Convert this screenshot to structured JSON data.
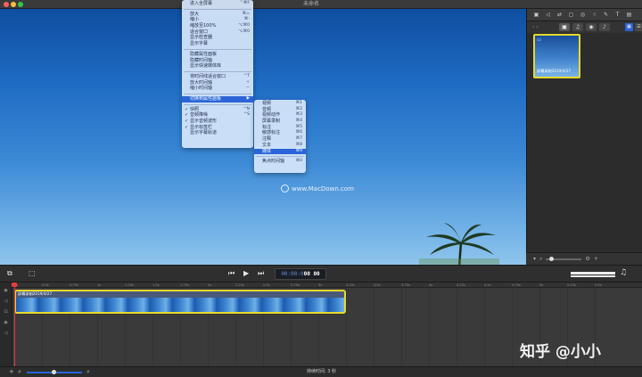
{
  "window": {
    "title": "未命名"
  },
  "menu_view": {
    "items": [
      {
        "label": "进入全屏幕",
        "shortcut": "⌃⌘F"
      },
      {
        "sep": true
      },
      {
        "label": "放大",
        "shortcut": "⌘="
      },
      {
        "label": "缩小",
        "shortcut": "⌘-"
      },
      {
        "label": "缩放至100%",
        "shortcut": "⌥⌘0"
      },
      {
        "label": "适合窗口",
        "shortcut": "⌥⌘0"
      },
      {
        "label": "显示检查器",
        "shortcut": ""
      },
      {
        "label": "显示字幕",
        "shortcut": ""
      },
      {
        "sep": true
      },
      {
        "label": "隐藏属性面板",
        "shortcut": ""
      },
      {
        "label": "隐藏时间轴",
        "shortcut": ""
      },
      {
        "label": "显示快速媒体库",
        "shortcut": ""
      },
      {
        "sep": true
      },
      {
        "label": "将时间线适合窗口",
        "shortcut": "^T"
      },
      {
        "label": "放大时间轴",
        "shortcut": "+"
      },
      {
        "label": "缩小时间轴",
        "shortcut": "−"
      },
      {
        "sep": true
      },
      {
        "label": "切换到属性面板",
        "shortcut": "▶",
        "highlight": true
      },
      {
        "sep": true
      },
      {
        "label": "快照",
        "shortcut": "^N",
        "check": true
      },
      {
        "label": "音频降噪",
        "shortcut": "^S",
        "check": true
      },
      {
        "label": "显示音频波形",
        "shortcut": "",
        "check": true
      },
      {
        "label": "显示标签栏",
        "shortcut": "",
        "check": true
      },
      {
        "label": "显示字幕轨道",
        "shortcut": ""
      }
    ]
  },
  "menu_properties": {
    "items": [
      {
        "label": "视频",
        "shortcut": "⌘1"
      },
      {
        "label": "音频",
        "shortcut": "⌘2"
      },
      {
        "label": "视频动作",
        "shortcut": "⌘3"
      },
      {
        "label": "屏幕录制",
        "shortcut": "⌘4"
      },
      {
        "label": "标注",
        "shortcut": "⌘5"
      },
      {
        "label": "敏感标注",
        "shortcut": "⌘6"
      },
      {
        "label": "注释",
        "shortcut": "⌘7"
      },
      {
        "label": "文本",
        "shortcut": "⌘8"
      },
      {
        "label": "媒体",
        "shortcut": "⌘9",
        "highlight": true
      },
      {
        "sep": true
      },
      {
        "label": "焦点时间轴",
        "shortcut": "⌘0"
      }
    ]
  },
  "watermark": {
    "text": "www.MacDown.com"
  },
  "library": {
    "thumb_label": "屏幕录制2019/4/27"
  },
  "transport": {
    "timecode_dim": "00:00:0",
    "timecode_bright": "00 00"
  },
  "timeline": {
    "clip_name": "屏幕录制2019/4/27",
    "ticks": [
      "0s",
      "0.5s",
      "0.75s",
      "1s",
      "1.25s",
      "1.5s",
      "1.75s",
      "2s",
      "2.25s",
      "2.5s",
      "2.75s",
      "3s",
      "3.25s",
      "3.5s",
      "3.75s",
      "4s",
      "4.25s",
      "4.5s",
      "4.75s",
      "5s",
      "5.25s",
      "5.5s"
    ]
  },
  "status": {
    "duration": "持续时间: 3 秒"
  },
  "overlay_watermark": {
    "text": "知乎 @小小"
  }
}
